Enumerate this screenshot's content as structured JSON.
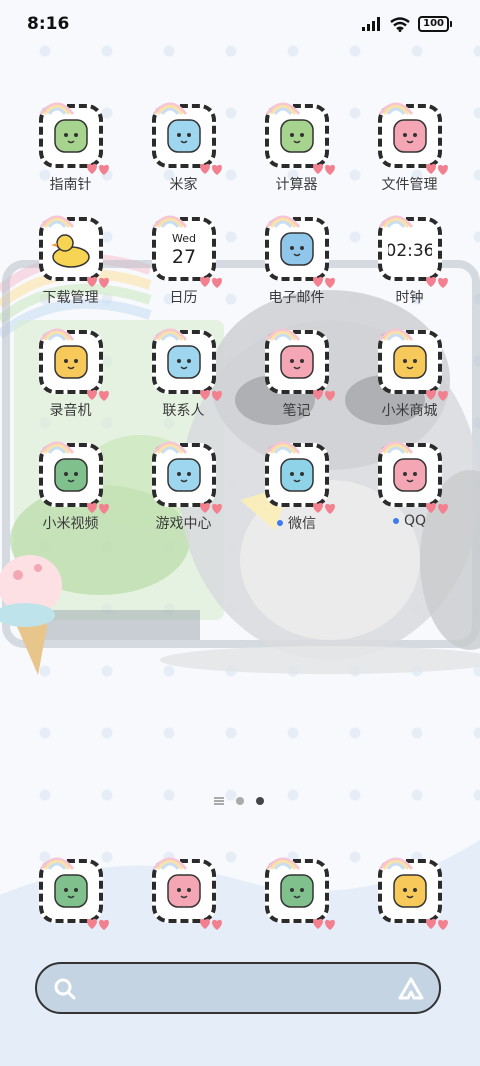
{
  "status_bar": {
    "time": "8:16",
    "battery": "100"
  },
  "home": {
    "apps": [
      {
        "label": "指南针",
        "icon": "compass-icon",
        "color": "#a6d38d"
      },
      {
        "label": "米家",
        "icon": "mijia-icon",
        "color": "#9dd6ee"
      },
      {
        "label": "计算器",
        "icon": "calculator-icon",
        "color": "#a6d38d"
      },
      {
        "label": "文件管理",
        "icon": "file-manager-icon",
        "color": "#f4a6b4"
      },
      {
        "label": "下载管理",
        "icon": "download-duck-icon",
        "color": "#f7d454"
      },
      {
        "label": "日历",
        "icon": "calendar-icon",
        "color": "#ffffff",
        "day": "Wed",
        "date": "27"
      },
      {
        "label": "电子邮件",
        "icon": "email-bird-icon",
        "color": "#8fc6ea"
      },
      {
        "label": "时钟",
        "icon": "clock-icon",
        "color": "#ffffff",
        "clock_text": "02:36"
      },
      {
        "label": "录音机",
        "icon": "recorder-icon",
        "color": "#f7c95a"
      },
      {
        "label": "联系人",
        "icon": "contacts-icon",
        "color": "#9dd6ee"
      },
      {
        "label": "笔记",
        "icon": "notes-icon",
        "color": "#f4a6b4"
      },
      {
        "label": "小米商城",
        "icon": "mi-store-icon",
        "color": "#f7c95a"
      },
      {
        "label": "小米视频",
        "icon": "mi-video-icon",
        "color": "#7fc08d"
      },
      {
        "label": "游戏中心",
        "icon": "game-center-icon",
        "color": "#9dd6ee"
      },
      {
        "label": "微信",
        "icon": "wechat-icon",
        "color": "#8fd3e8",
        "notify": true
      },
      {
        "label": "QQ",
        "icon": "qq-icon",
        "color": "#f4a6b4",
        "notify": true
      }
    ]
  },
  "pager": {
    "pages": 2,
    "active": 2
  },
  "dock": {
    "apps": [
      {
        "icon": "phone-icon",
        "color": "#7fc08d"
      },
      {
        "icon": "browser-planet-icon",
        "color": "#f4a6b4"
      },
      {
        "icon": "messages-icon",
        "color": "#7fc08d"
      },
      {
        "icon": "camera-cat-icon",
        "color": "#f7c95a"
      }
    ]
  },
  "search": {
    "placeholder": ""
  },
  "colors": {
    "accent": "#3a7bf0",
    "frame": "#2b2b2b",
    "search_bg": "#c4d4e3"
  }
}
